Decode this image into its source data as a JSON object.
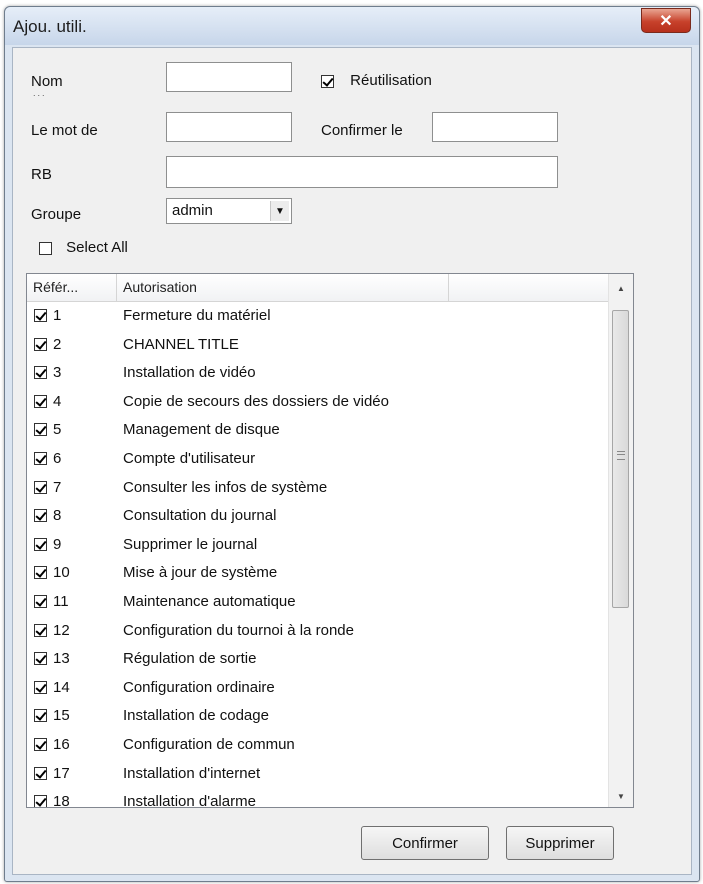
{
  "window": {
    "title": "Ajou. utili.",
    "close_glyph": "✕"
  },
  "form": {
    "nom_label": "Nom",
    "nom_sublabel": "...",
    "password_label": "Le mot de",
    "confirm_label": "Confirmer le",
    "rb_label": "RB",
    "group_label": "Groupe",
    "group_value": "admin",
    "reuse_label": "Réutilisation",
    "reuse_checked": true,
    "select_all_label": "Select All",
    "select_all_checked": false
  },
  "table": {
    "headers": [
      "Référ...",
      "Autorisation"
    ],
    "rows": [
      {
        "ref": "1",
        "auth": "Fermeture du matériel",
        "checked": true
      },
      {
        "ref": "2",
        "auth": "CHANNEL TITLE",
        "checked": true
      },
      {
        "ref": "3",
        "auth": "Installation de vidéo",
        "checked": true
      },
      {
        "ref": "4",
        "auth": "Copie de secours des dossiers de vidéo",
        "checked": true
      },
      {
        "ref": "5",
        "auth": "Management de disque",
        "checked": true
      },
      {
        "ref": "6",
        "auth": "Compte d'utilisateur",
        "checked": true
      },
      {
        "ref": "7",
        "auth": "Consulter les infos de système",
        "checked": true
      },
      {
        "ref": "8",
        "auth": "Consultation du journal",
        "checked": true
      },
      {
        "ref": "9",
        "auth": "Supprimer le journal",
        "checked": true
      },
      {
        "ref": "10",
        "auth": "Mise à jour de système",
        "checked": true
      },
      {
        "ref": "11",
        "auth": "Maintenance automatique",
        "checked": true
      },
      {
        "ref": "12",
        "auth": "Configuration du tournoi à la ronde",
        "checked": true
      },
      {
        "ref": "13",
        "auth": "Régulation de sortie",
        "checked": true
      },
      {
        "ref": "14",
        "auth": "Configuration ordinaire",
        "checked": true
      },
      {
        "ref": "15",
        "auth": "Installation de codage",
        "checked": true
      },
      {
        "ref": "16",
        "auth": "Configuration de commun",
        "checked": true
      },
      {
        "ref": "17",
        "auth": "Installation d'internet",
        "checked": true
      },
      {
        "ref": "18",
        "auth": "Installation d'alarme",
        "checked": true
      }
    ]
  },
  "buttons": {
    "confirm": "Confirmer",
    "delete": "Supprimer"
  }
}
